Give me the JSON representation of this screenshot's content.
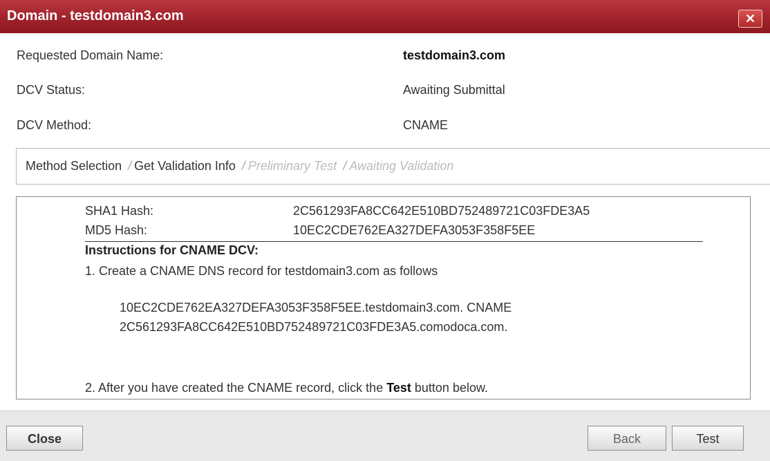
{
  "window": {
    "title": "Domain - testdomain3.com",
    "close_glyph": "✕",
    "title_bar_color": "#a1222b"
  },
  "info": {
    "requested_label": "Requested Domain Name:",
    "requested_value": "testdomain3.com",
    "dcv_status_label": "DCV Status:",
    "dcv_status_value": "Awaiting Submittal",
    "dcv_method_label": "DCV Method:",
    "dcv_method_value": "CNAME"
  },
  "steps": {
    "items": [
      "Method Selection",
      "Get Validation Info",
      "Preliminary Test",
      "Awaiting Validation"
    ],
    "separator": "/",
    "active_through": 1
  },
  "panel": {
    "sha1_label": "SHA1 Hash:",
    "sha1_value": "2C561293FA8CC642E510BD752489721C03FDE3A5",
    "md5_label": "MD5 Hash:",
    "md5_value": "10EC2CDE762EA327DEFA3053F358F5EE",
    "instructions_title": "Instructions for CNAME DCV:",
    "step1": "1. Create a CNAME DNS record for testdomain3.com as follows",
    "dns_line1": "10EC2CDE762EA327DEFA3053F358F5EE.testdomain3.com. CNAME",
    "dns_line2": "2C561293FA8CC642E510BD752489721C03FDE3A5.comodoca.com.",
    "step2_prefix": "2. After you have created the CNAME record, click the ",
    "step2_bold": "Test",
    "step2_suffix": " button below."
  },
  "footer": {
    "close_label": "Close",
    "back_label": "Back",
    "test_label": "Test"
  }
}
